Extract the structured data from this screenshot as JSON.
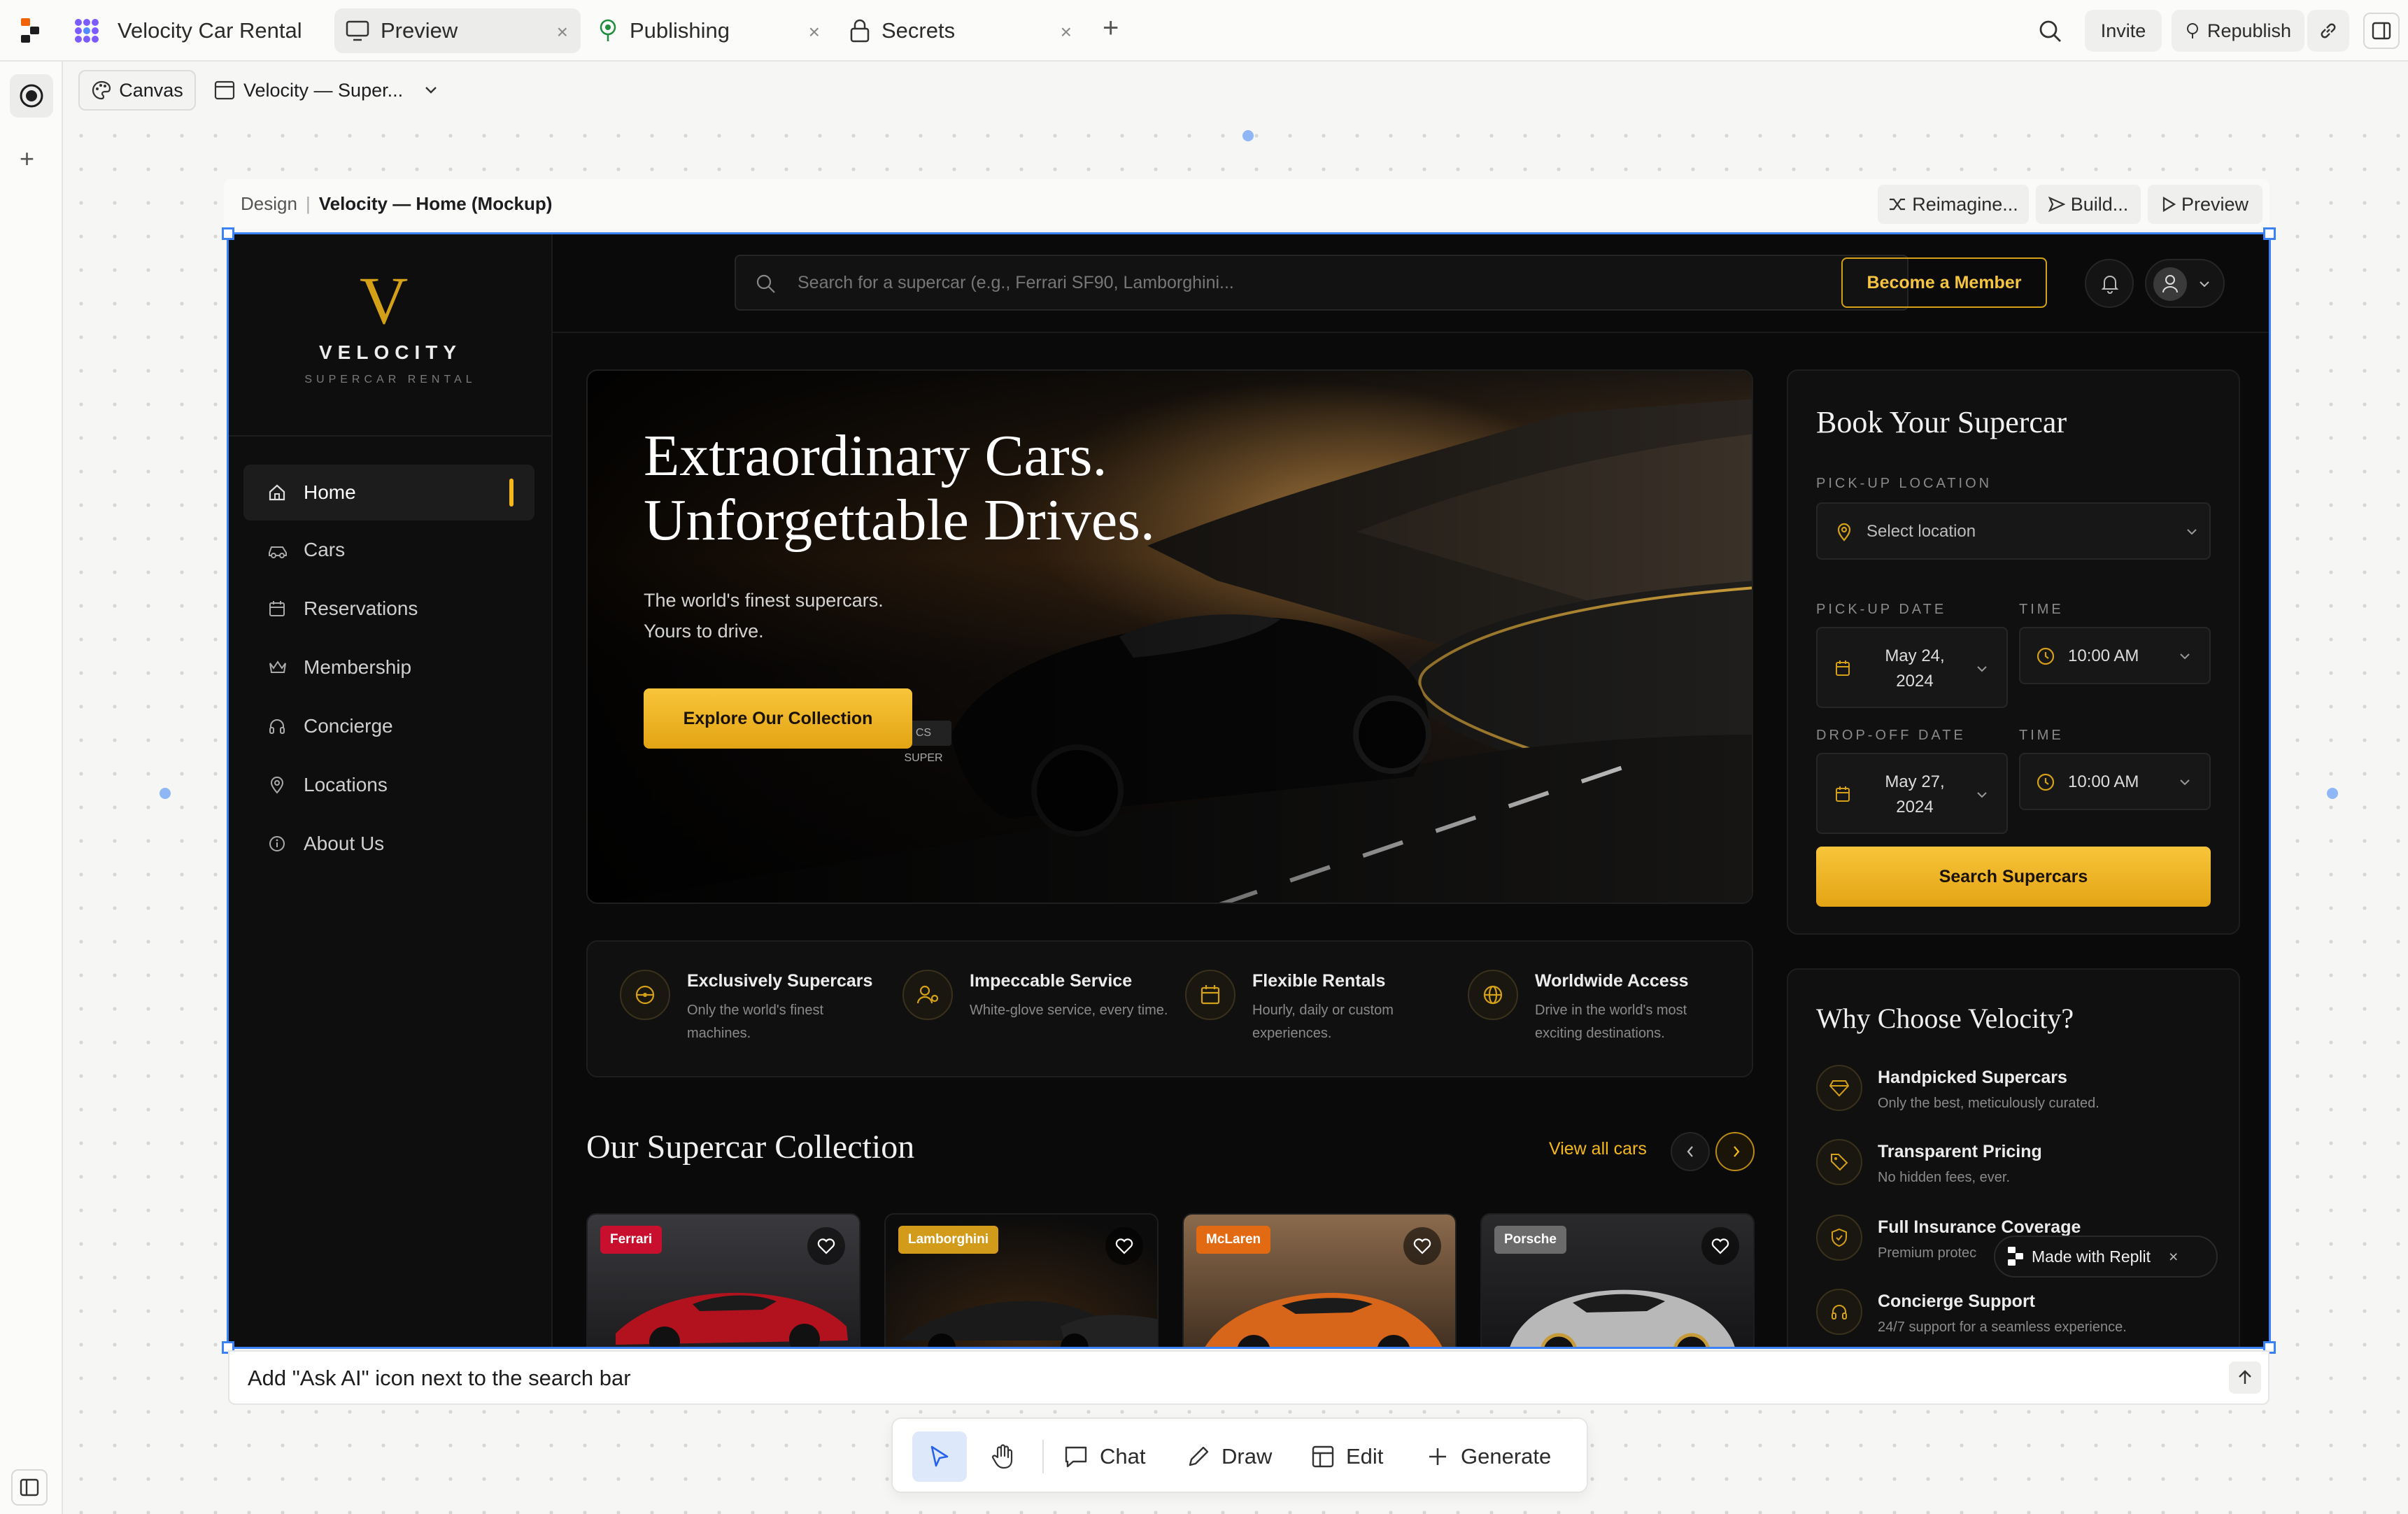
{
  "topbar": {
    "project_name": "Velocity Car Rental",
    "tabs": [
      {
        "label": "Preview",
        "icon": "monitor-icon"
      },
      {
        "label": "Publishing",
        "icon": "publishing-icon"
      },
      {
        "label": "Secrets",
        "icon": "lock-icon"
      }
    ],
    "close_glyph": "×",
    "new_tab_glyph": "+",
    "invite_label": "Invite",
    "republish_label": "Republish"
  },
  "subbar": {
    "canvas_label": "Canvas",
    "frame_select": "Velocity — Super..."
  },
  "frame_header": {
    "crumb_root": "Design",
    "crumb_sep": "|",
    "crumb_current": "Velocity — Home (Mockup)",
    "reimagine_label": "Reimagine...",
    "build_label": "Build...",
    "preview_label": "Preview"
  },
  "app": {
    "logo_letter": "V",
    "brand": "VELOCITY",
    "brand_sub": "SUPERCAR RENTAL",
    "nav": [
      {
        "label": "Home",
        "icon": "home-icon",
        "active": true
      },
      {
        "label": "Cars",
        "icon": "car-icon"
      },
      {
        "label": "Reservations",
        "icon": "calendar-icon"
      },
      {
        "label": "Membership",
        "icon": "crown-icon"
      },
      {
        "label": "Concierge",
        "icon": "headset-icon"
      },
      {
        "label": "Locations",
        "icon": "map-pin-icon"
      },
      {
        "label": "About Us",
        "icon": "info-icon"
      }
    ],
    "search_placeholder": "Search for a supercar (e.g., Ferrari SF90, Lamborghini...",
    "member_button": "Become a Member",
    "hero": {
      "title_line1": "Extraordinary Cars.",
      "title_line2": "Unforgettable Drives.",
      "subtitle_line1": "The world's finest supercars.",
      "subtitle_line2": "Yours to drive.",
      "cta": "Explore Our Collection",
      "plate": "CS SUPER"
    },
    "features": [
      {
        "title": "Exclusively Supercars",
        "desc": "Only the world's finest machines.",
        "icon": "steering-wheel-icon"
      },
      {
        "title": "Impeccable Service",
        "desc": "White-glove service, every time.",
        "icon": "concierge-icon"
      },
      {
        "title": "Flexible Rentals",
        "desc": "Hourly, daily or custom experiences.",
        "icon": "calendar-icon"
      },
      {
        "title": "Worldwide Access",
        "desc": "Drive in the world's most exciting destinations.",
        "icon": "globe-icon"
      }
    ],
    "collection": {
      "title": "Our Supercar Collection",
      "view_all": "View all cars",
      "cars": [
        {
          "brand": "Ferrari",
          "color": "#c8102e"
        },
        {
          "brand": "Lamborghini",
          "color": "#d39b1a"
        },
        {
          "brand": "McLaren",
          "color": "#e26a12"
        },
        {
          "brand": "Porsche",
          "color": "#6b6b6b"
        }
      ]
    },
    "booking": {
      "title": "Book Your Supercar",
      "pickup_location_label": "PICK-UP LOCATION",
      "pickup_location_placeholder": "Select location",
      "pickup_date_label": "PICK-UP DATE",
      "pickup_date_line1": "May 24,",
      "pickup_date_line2": "2024",
      "time_label": "TIME",
      "pickup_time": "10:00 AM",
      "dropoff_date_label": "DROP-OFF DATE",
      "dropoff_date_line1": "May 27,",
      "dropoff_date_line2": "2024",
      "dropoff_time_label": "TIME",
      "dropoff_time": "10:00 AM",
      "search_button": "Search Supercars"
    },
    "why": {
      "title": "Why Choose Velocity?",
      "items": [
        {
          "title": "Handpicked Supercars",
          "desc": "Only the best, meticulously curated.",
          "icon": "diamond-icon"
        },
        {
          "title": "Transparent Pricing",
          "desc": "No hidden fees, ever.",
          "icon": "tag-icon"
        },
        {
          "title": "Full Insurance Coverage",
          "desc": "Premium protec",
          "icon": "shield-icon"
        },
        {
          "title": "Concierge Support",
          "desc": "24/7 support for a seamless experience.",
          "icon": "headset-icon"
        }
      ]
    },
    "made_with": "Made with Replit"
  },
  "prompt": {
    "value": "Add \"Ask AI\" icon next to the search bar"
  },
  "toolbar": {
    "chat": "Chat",
    "draw": "Draw",
    "edit": "Edit",
    "generate": "Generate"
  },
  "colors": {
    "accent": "#f5b81c",
    "selection": "#3b82f6",
    "replit": "#f26207"
  }
}
